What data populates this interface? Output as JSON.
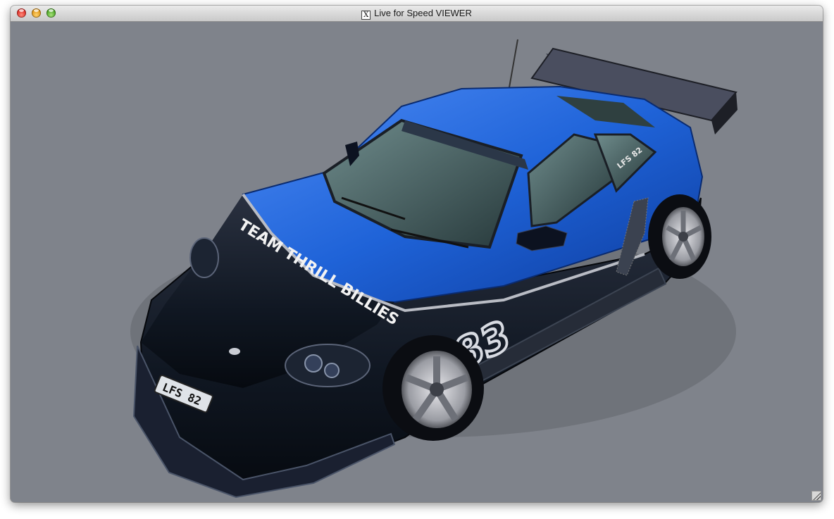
{
  "window": {
    "title": "Live for Speed VIEWER"
  },
  "car": {
    "hood_text": "TEAM THRILL BILLIES",
    "door_number": "83",
    "plate": "LFS 82",
    "rear_window_text": "LFS 82"
  },
  "colors": {
    "background": "#7f838b",
    "car_blue": "#1f63d8",
    "car_black": "#101722"
  }
}
